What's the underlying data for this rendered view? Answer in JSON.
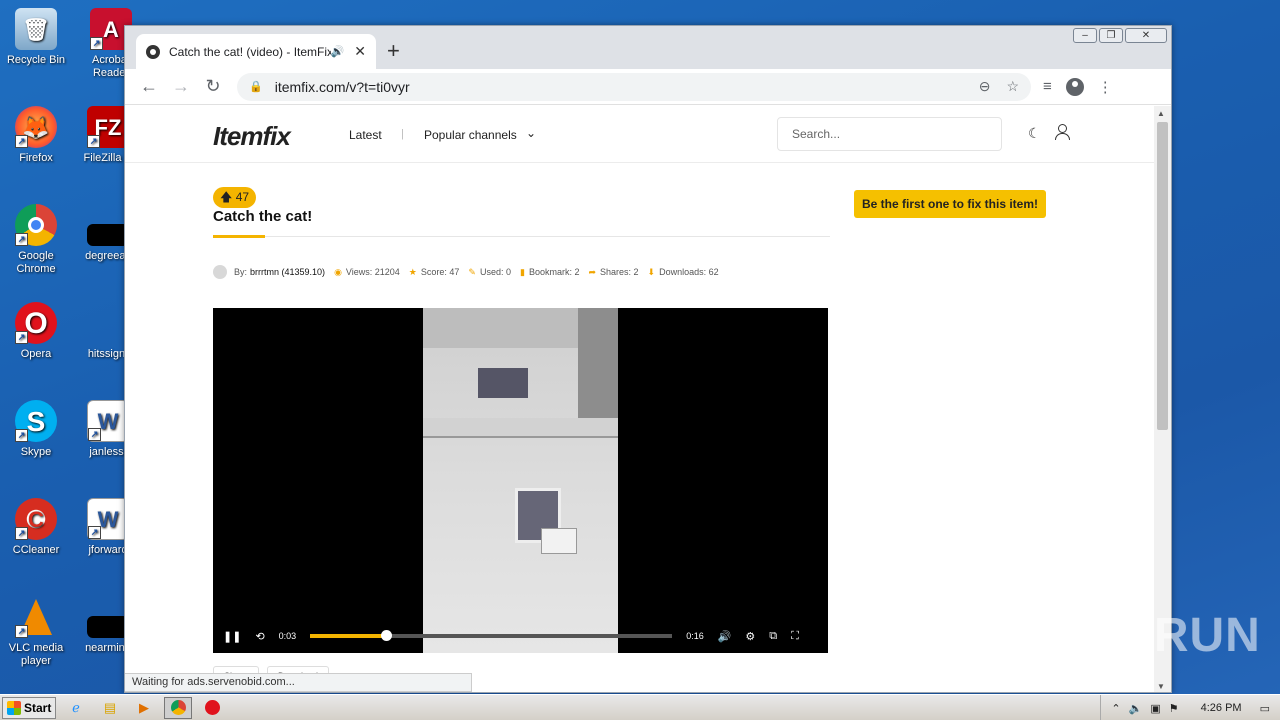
{
  "desktop": {
    "icons": [
      {
        "label": "Recycle Bin"
      },
      {
        "label": "Acrobat Reader"
      },
      {
        "label": "Firefox"
      },
      {
        "label": "FileZilla C"
      },
      {
        "label": "Google Chrome"
      },
      {
        "label": "degreeac"
      },
      {
        "label": "Opera"
      },
      {
        "label": "hitssign."
      },
      {
        "label": "Skype"
      },
      {
        "label": "janless."
      },
      {
        "label": "CCleaner"
      },
      {
        "label": "jforward"
      },
      {
        "label": "VLC media player"
      },
      {
        "label": "nearminu"
      }
    ]
  },
  "browser": {
    "tab_title": "Catch the cat! (video) - ItemFix",
    "url": "itemfix.com/v?t=ti0vyr",
    "status_text": "Waiting for ads.servenobid.com..."
  },
  "site": {
    "logo": "Itemfix",
    "nav": {
      "latest": "Latest",
      "popular": "Popular channels"
    },
    "search_placeholder": "Search..."
  },
  "item": {
    "score": "47",
    "title": "Catch the cat!",
    "fix_button": "Be the first one to fix this item!",
    "meta": {
      "by_label": "By:",
      "author": "brrrtmn (41359.10)",
      "views": "Views: 21204",
      "score": "Score: 47",
      "used": "Used: 0",
      "bookmark": "Bookmark: 2",
      "shares": "Shares: 2",
      "downloads": "Downloads: 62"
    },
    "player": {
      "current_time": "0:03",
      "duration": "0:16",
      "progress_fraction": 0.21
    },
    "buttons": {
      "share": "Share",
      "download": "Download"
    }
  },
  "taskbar": {
    "start_label": "Start",
    "clock": "4:26 PM"
  },
  "watermark": "ANY RUN",
  "colors": {
    "accent": "#f4b400",
    "fix_button": "#f5c000"
  }
}
